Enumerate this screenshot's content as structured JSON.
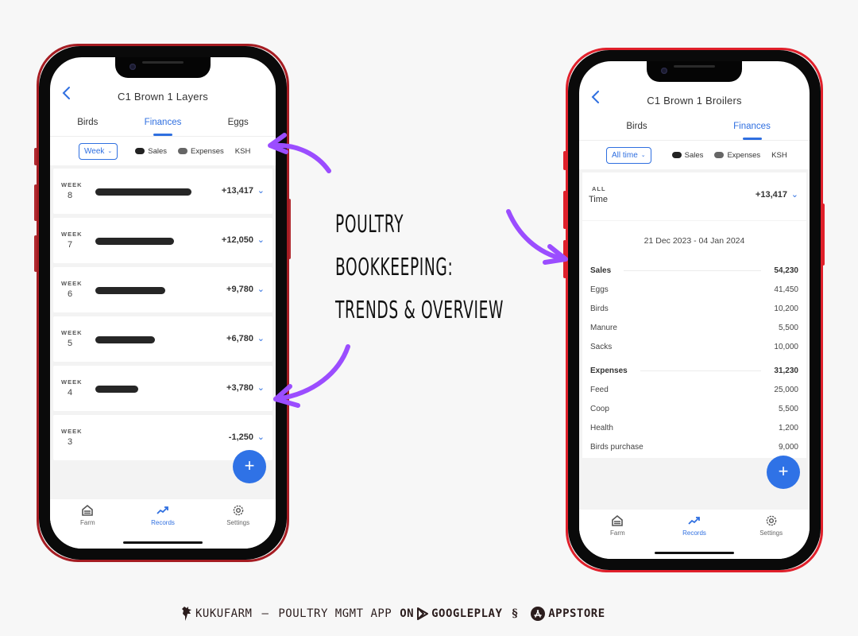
{
  "headline": {
    "lines": [
      "POULTRY",
      "BOOKKEEPING:",
      "TRENDS & OVERVIEW"
    ]
  },
  "footer": {
    "brand": "KUKUFARM",
    "dash": "—",
    "tagline": "POULTRY MGMT APP",
    "on": "ON",
    "googleplay": "GOOGLEPLAY",
    "separator": "§",
    "appstore": "APPSTORE",
    "icons": [
      "rooster-icon",
      "google-play-icon",
      "app-store-icon"
    ]
  },
  "left_phone": {
    "title": "C1 Brown 1 Layers",
    "tabs": [
      {
        "label": "Birds",
        "active": false
      },
      {
        "label": "Finances",
        "active": true
      },
      {
        "label": "Eggs",
        "active": false
      }
    ],
    "filter": {
      "period": "Week",
      "legend_sales": "Sales",
      "legend_expenses": "Expenses",
      "currency": "KSH"
    },
    "weeks": [
      {
        "label": "WEEK",
        "number": "8",
        "value": "+13,417",
        "bar_fraction": 1.0
      },
      {
        "label": "WEEK",
        "number": "7",
        "value": "+12,050",
        "bar_fraction": 0.82
      },
      {
        "label": "WEEK",
        "number": "6",
        "value": "+9,780",
        "bar_fraction": 0.73
      },
      {
        "label": "WEEK",
        "number": "5",
        "value": "+6,780",
        "bar_fraction": 0.62
      },
      {
        "label": "WEEK",
        "number": "4",
        "value": "+3,780",
        "bar_fraction": 0.45
      },
      {
        "label": "WEEK",
        "number": "3",
        "value": "-1,250",
        "bar_fraction": 0
      }
    ],
    "fab": "+",
    "nav": [
      {
        "label": "Farm",
        "icon": "barn-icon",
        "active": false
      },
      {
        "label": "Records",
        "icon": "trending-up-icon",
        "active": true
      },
      {
        "label": "Settings",
        "icon": "gear-icon",
        "active": false
      }
    ]
  },
  "right_phone": {
    "title": "C1 Brown 1 Broilers",
    "tabs": [
      {
        "label": "Birds",
        "active": false
      },
      {
        "label": "Finances",
        "active": true
      }
    ],
    "filter": {
      "period": "All time",
      "legend_sales": "Sales",
      "legend_expenses": "Expenses",
      "currency": "KSH"
    },
    "summary": {
      "label_top": "ALL",
      "label_bottom": "Time",
      "value": "+13,417"
    },
    "date_range": "21 Dec 2023 - 04 Jan 2024",
    "sales": {
      "label": "Sales",
      "total": "54,230",
      "items": [
        {
          "name": "Eggs",
          "amount": "41,450"
        },
        {
          "name": "Birds",
          "amount": "10,200"
        },
        {
          "name": "Manure",
          "amount": "5,500"
        },
        {
          "name": "Sacks",
          "amount": "10,000"
        }
      ]
    },
    "expenses": {
      "label": "Expenses",
      "total": "31,230",
      "items": [
        {
          "name": "Feed",
          "amount": "25,000"
        },
        {
          "name": "Coop",
          "amount": "5,500"
        },
        {
          "name": "Health",
          "amount": "1,200"
        },
        {
          "name": "Birds purchase",
          "amount": "9,000"
        }
      ]
    },
    "fab": "+",
    "nav": [
      {
        "label": "Farm",
        "icon": "barn-icon",
        "active": false
      },
      {
        "label": "Records",
        "icon": "trending-up-icon",
        "active": true
      },
      {
        "label": "Settings",
        "icon": "gear-icon",
        "active": false
      }
    ]
  },
  "colors": {
    "accent": "#2f6fe0",
    "fab": "#2f72e6",
    "arrow": "#9b4dff",
    "left_frame": "#a51c22",
    "right_frame": "#e0202b",
    "bar": "#262626",
    "background": "#f7f7f7"
  }
}
